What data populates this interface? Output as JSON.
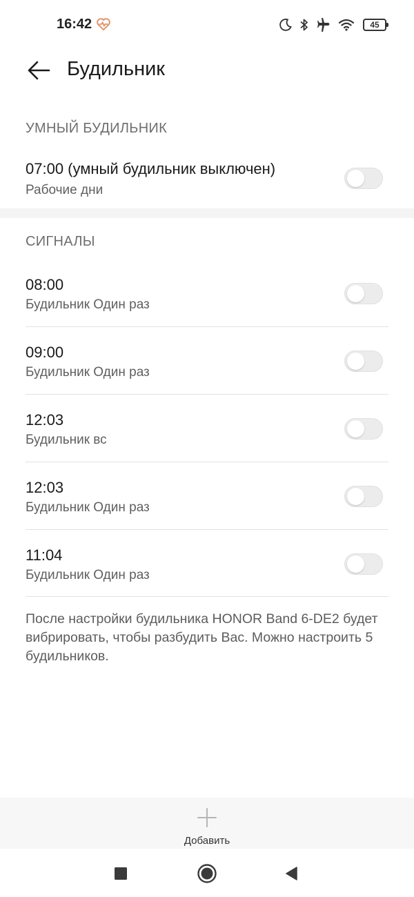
{
  "status_bar": {
    "time": "16:42",
    "battery": "45",
    "icons": [
      "heart-pulse-icon",
      "moon-icon",
      "bluetooth-icon",
      "airplane-icon",
      "wifi-icon",
      "battery-icon"
    ]
  },
  "header": {
    "title": "Будильник"
  },
  "smart_section": {
    "label": "УМНЫЙ БУДИЛЬНИК",
    "alarm": {
      "time": "07:00 (умный будильник выключен)",
      "repeat": "Рабочие дни",
      "enabled": false
    }
  },
  "signals_section": {
    "label": "СИГНАЛЫ",
    "alarms": [
      {
        "time": "08:00",
        "repeat": "Будильник Один раз",
        "enabled": false
      },
      {
        "time": "09:00",
        "repeat": "Будильник Один раз",
        "enabled": false
      },
      {
        "time": "12:03",
        "repeat": "Будильник вс",
        "enabled": false
      },
      {
        "time": "12:03",
        "repeat": "Будильник Один раз",
        "enabled": false
      },
      {
        "time": "11:04",
        "repeat": "Будильник Один раз",
        "enabled": false
      }
    ]
  },
  "note": "После настройки будильника HONOR Band 6-DE2 будет вибрировать, чтобы разбудить Вас. Можно настроить 5 будильников.",
  "bottom": {
    "add_label": "Добавить"
  },
  "colors": {
    "heart": "#e0956b",
    "toggle_off": "#ececec",
    "section_text": "#6e6e6e"
  }
}
